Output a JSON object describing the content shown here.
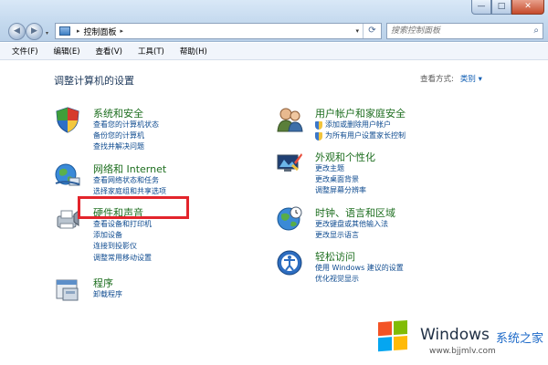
{
  "window": {
    "minimize": "—",
    "maximize": "□",
    "close": "✕"
  },
  "nav": {
    "back": "◀",
    "forward": "▶",
    "dropdown": "▾"
  },
  "address": {
    "separator": "▸",
    "path": "控制面板",
    "arrow_after": "▸",
    "dropdown": "▾",
    "refresh": "⟳"
  },
  "search": {
    "placeholder": "搜索控制面板",
    "icon": "⌕"
  },
  "menu": [
    {
      "label": "文件(F)"
    },
    {
      "label": "编辑(E)"
    },
    {
      "label": "查看(V)"
    },
    {
      "label": "工具(T)"
    },
    {
      "label": "帮助(H)"
    }
  ],
  "page": {
    "title": "调整计算机的设置",
    "view_by_label": "查看方式:",
    "view_by_value": "类别 ▾"
  },
  "categories": {
    "system_security": {
      "title": "系统和安全",
      "links": [
        "查看您的计算机状态",
        "备份您的计算机",
        "查找并解决问题"
      ]
    },
    "network": {
      "title": "网络和 Internet",
      "links": [
        "查看网络状态和任务",
        "选择家庭组和共享选项"
      ]
    },
    "hardware": {
      "title": "硬件和声音",
      "links": [
        "查看设备和打印机",
        "添加设备",
        "连接到投影仪",
        "调整常用移动设置"
      ]
    },
    "programs": {
      "title": "程序",
      "links": [
        "卸载程序"
      ]
    },
    "user_accounts": {
      "title": "用户帐户和家庭安全",
      "links": [
        "添加或删除用户帐户",
        "为所有用户设置家长控制"
      ]
    },
    "appearance": {
      "title": "外观和个性化",
      "links": [
        "更改主题",
        "更改桌面背景",
        "调整屏幕分辨率"
      ]
    },
    "clock": {
      "title": "时钟、语言和区域",
      "links": [
        "更改键盘或其他输入法",
        "更改显示语言"
      ]
    },
    "ease": {
      "title": "轻松访问",
      "links": [
        "使用 Windows 建议的设置",
        "优化视觉显示"
      ]
    }
  },
  "watermark": {
    "brand": "Windows",
    "brand_cn": "系统之家",
    "url": "www.bjjmlv.com"
  },
  "colors": {
    "category_title": "#1d6e1f",
    "link": "#0d4a8f",
    "highlight": "#e3242b"
  }
}
